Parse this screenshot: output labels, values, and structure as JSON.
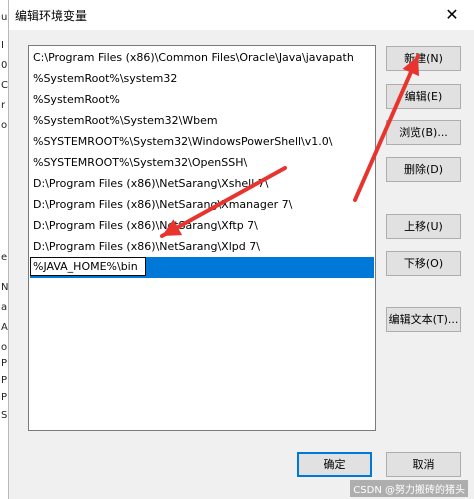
{
  "window": {
    "title": "编辑环境变量",
    "close_label": "✕"
  },
  "background_fragments": [
    "u",
    "I",
    "0",
    "C",
    "r",
    "o",
    "e",
    "N",
    "a",
    "A",
    "o",
    "P",
    "P",
    "P",
    "S"
  ],
  "paths": [
    "C:\\Program Files (x86)\\Common Files\\Oracle\\Java\\javapath",
    "%SystemRoot%\\system32",
    "%SystemRoot%",
    "%SystemRoot%\\System32\\Wbem",
    "%SYSTEMROOT%\\System32\\WindowsPowerShell\\v1.0\\",
    "%SYSTEMROOT%\\System32\\OpenSSH\\",
    "D:\\Program Files (x86)\\NetSarang\\Xshell 7\\",
    "D:\\Program Files (x86)\\NetSarang\\Xmanager 7\\",
    "D:\\Program Files (x86)\\NetSarang\\Xftp 7\\",
    "D:\\Program Files (x86)\\NetSarang\\Xlpd 7\\"
  ],
  "editing": {
    "value": "%JAVA_HOME%\\bin"
  },
  "buttons": {
    "new": "新建(N)",
    "edit": "编辑(E)",
    "browse": "浏览(B)...",
    "delete": "删除(D)",
    "move_up": "上移(U)",
    "move_down": "下移(O)",
    "edit_text": "编辑文本(T)...",
    "ok": "确定",
    "cancel": "取消"
  },
  "colors": {
    "selection": "#0078d7",
    "annotation_arrow": "#e8342e"
  },
  "watermark": "CSDN @努力搬砖的猪头"
}
